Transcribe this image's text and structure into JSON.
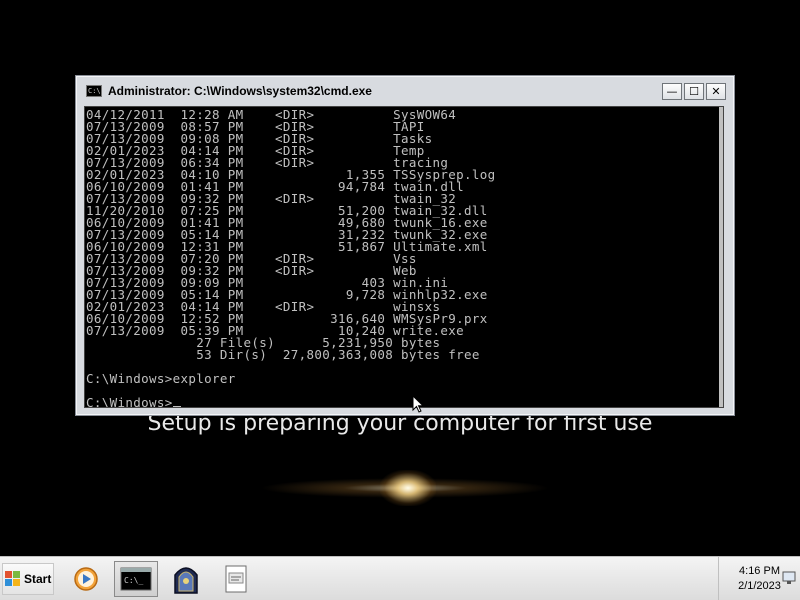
{
  "window": {
    "title": "Administrator: C:\\Windows\\system32\\cmd.exe",
    "minimize": "—",
    "maximize": "☐",
    "close": "✕"
  },
  "console_lines": [
    "04/12/2011  12:28 AM    <DIR>          SysWOW64",
    "07/13/2009  08:57 PM    <DIR>          TAPI",
    "07/13/2009  09:08 PM    <DIR>          Tasks",
    "02/01/2023  04:14 PM    <DIR>          Temp",
    "07/13/2009  06:34 PM    <DIR>          tracing",
    "02/01/2023  04:10 PM             1,355 TSSysprep.log",
    "06/10/2009  01:41 PM            94,784 twain.dll",
    "07/13/2009  09:32 PM    <DIR>          twain_32",
    "11/20/2010  07:25 PM            51,200 twain_32.dll",
    "06/10/2009  01:41 PM            49,680 twunk_16.exe",
    "07/13/2009  05:14 PM            31,232 twunk_32.exe",
    "06/10/2009  12:31 PM            51,867 Ultimate.xml",
    "07/13/2009  07:20 PM    <DIR>          Vss",
    "07/13/2009  09:32 PM    <DIR>          Web",
    "07/13/2009  09:09 PM               403 win.ini",
    "07/13/2009  05:14 PM             9,728 winhlp32.exe",
    "02/01/2023  04:14 PM    <DIR>          winsxs",
    "06/10/2009  12:52 PM           316,640 WMSysPr9.prx",
    "07/13/2009  05:39 PM            10,240 write.exe",
    "              27 File(s)      5,231,950 bytes",
    "              53 Dir(s)  27,800,363,008 bytes free",
    "",
    "C:\\Windows>explorer",
    ""
  ],
  "prompt": "C:\\Windows>",
  "setup_message": "Setup is preparing your computer for first use",
  "taskbar": {
    "start_label": "Start",
    "time": "4:16 PM",
    "date": "2/1/2023"
  },
  "icons": {
    "start": "windows-flag-icon",
    "media": "media-player-icon",
    "cmd": "command-prompt-icon",
    "setup": "setup-arch-icon",
    "notepad": "document-icon",
    "tray": "network-icon"
  }
}
